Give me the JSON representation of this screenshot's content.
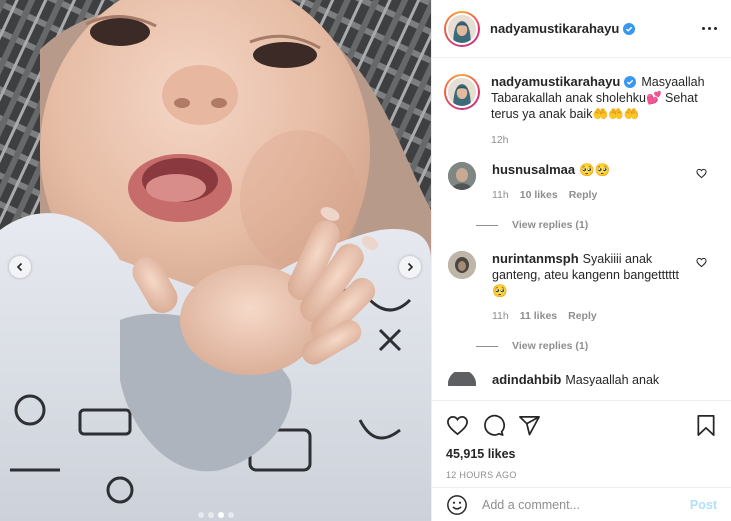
{
  "post": {
    "username": "nadyamustikarahayu",
    "verified": true,
    "caption": "Masyaallah Tabarakallah anak sholehku💕 Sehat terus ya anak baik🤲🤲🤲",
    "caption_time": "12h",
    "likes": "45,915 likes",
    "timestamp": "12 HOURS AGO",
    "carousel": {
      "total": 4,
      "active_index": 2
    }
  },
  "comments": [
    {
      "username": "husnusalmaa",
      "text": "🥺🥺",
      "time": "11h",
      "likes": "10 likes",
      "reply_label": "Reply",
      "view_replies": "View replies (1)"
    },
    {
      "username": "nurintanmsph",
      "text": "Syakiiii anak ganteng, ateu kangenn bangetttttt🥺",
      "time": "11h",
      "likes": "11 likes",
      "reply_label": "Reply",
      "view_replies": "View replies (1)"
    },
    {
      "username": "adindahbib",
      "text": "Masyaallah anak sholeh",
      "time": "",
      "likes": "",
      "reply_label": "",
      "view_replies": ""
    }
  ],
  "add_comment": {
    "placeholder": "Add a comment...",
    "post_label": "Post"
  },
  "icons": {
    "more": "more-options-icon",
    "verified": "verified-badge-icon",
    "like": "heart-icon",
    "comment": "comment-icon",
    "share": "share-icon",
    "save": "bookmark-icon",
    "emoji": "emoji-icon",
    "prev": "chevron-left-icon",
    "next": "chevron-right-icon"
  },
  "colors": {
    "verified": "#3897f0",
    "text": "#262626",
    "muted": "#8e8e8e",
    "post_button_disabled": "#b2dffc"
  }
}
